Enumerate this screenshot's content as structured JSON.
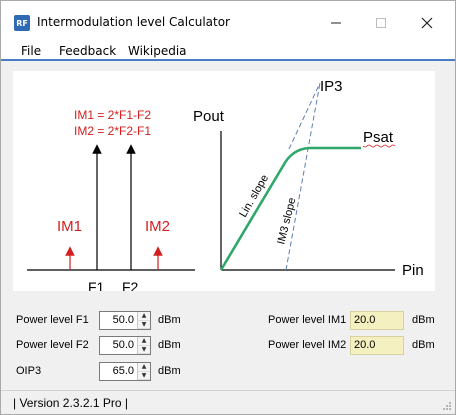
{
  "window": {
    "title": "Intermodulation level Calculator",
    "app_icon_text": "RF"
  },
  "menu": {
    "items": [
      "File",
      "Feedback",
      "Wikipedia"
    ]
  },
  "diagram": {
    "left": {
      "formula1": "IM1 = 2*F1-F2",
      "formula2": "IM2 = 2*F2-F1",
      "label_im1": "IM1",
      "label_im2": "IM2",
      "label_f1": "F1",
      "label_f2": "F2"
    },
    "right": {
      "label_pout": "Pout",
      "label_pin": "Pin",
      "label_ip3": "IP3",
      "label_psat": "Psat",
      "label_lin_slope": "Lin. slope",
      "label_im3_slope": "IM3 slope"
    },
    "colors": {
      "red": "#d22020",
      "green": "#2fa86a",
      "dash": "#5b7fb0"
    }
  },
  "form": {
    "f1": {
      "label": "Power level F1",
      "value": "50.0",
      "unit": "dBm"
    },
    "f2": {
      "label": "Power level F2",
      "value": "50.0",
      "unit": "dBm"
    },
    "oip3": {
      "label": "OIP3",
      "value": "65.0",
      "unit": "dBm"
    },
    "im1": {
      "label": "Power level IM1",
      "value": "20.0",
      "unit": "dBm"
    },
    "im2": {
      "label": "Power level IM2",
      "value": "20.0",
      "unit": "dBm"
    }
  },
  "status": {
    "text": "| Version 2.3.2.1 Pro |"
  }
}
